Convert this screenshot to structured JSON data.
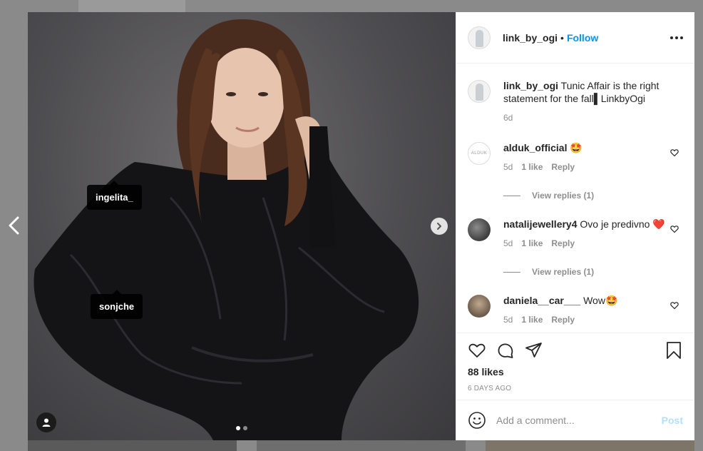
{
  "post": {
    "username": "link_by_ogi",
    "separator": "•",
    "follow_label": "Follow",
    "photo_tags": [
      "ingelita_",
      "sonjche"
    ],
    "carousel": {
      "count": 2,
      "active": 0
    }
  },
  "caption": {
    "username": "link_by_ogi",
    "text": "Tunic Affair is the right statement for the fall▌LinkbyOgi",
    "time": "6d"
  },
  "comments": [
    {
      "username": "alduk_official",
      "text": "🤩",
      "time": "5d",
      "likes": "1 like",
      "reply": "Reply",
      "view_replies": "View replies (1)",
      "avatar_text": "ALDUK"
    },
    {
      "username": "natalijewellery4",
      "text": "Ovo je predivno ❤️",
      "time": "5d",
      "likes": "1 like",
      "reply": "Reply",
      "view_replies": "View replies (1)"
    },
    {
      "username": "daniela__car___",
      "text": "Wow🤩",
      "time": "5d",
      "likes": "1 like",
      "reply": "Reply"
    }
  ],
  "stats": {
    "likes": "88 likes",
    "ago": "6 DAYS AGO"
  },
  "compose": {
    "placeholder": "Add a comment...",
    "post_label": "Post"
  },
  "colors": {
    "accent": "#0095f6",
    "post_disabled": "#b2dffc",
    "text": "#262626",
    "muted": "#8e8e8e",
    "heart_red": "#ed4956"
  }
}
